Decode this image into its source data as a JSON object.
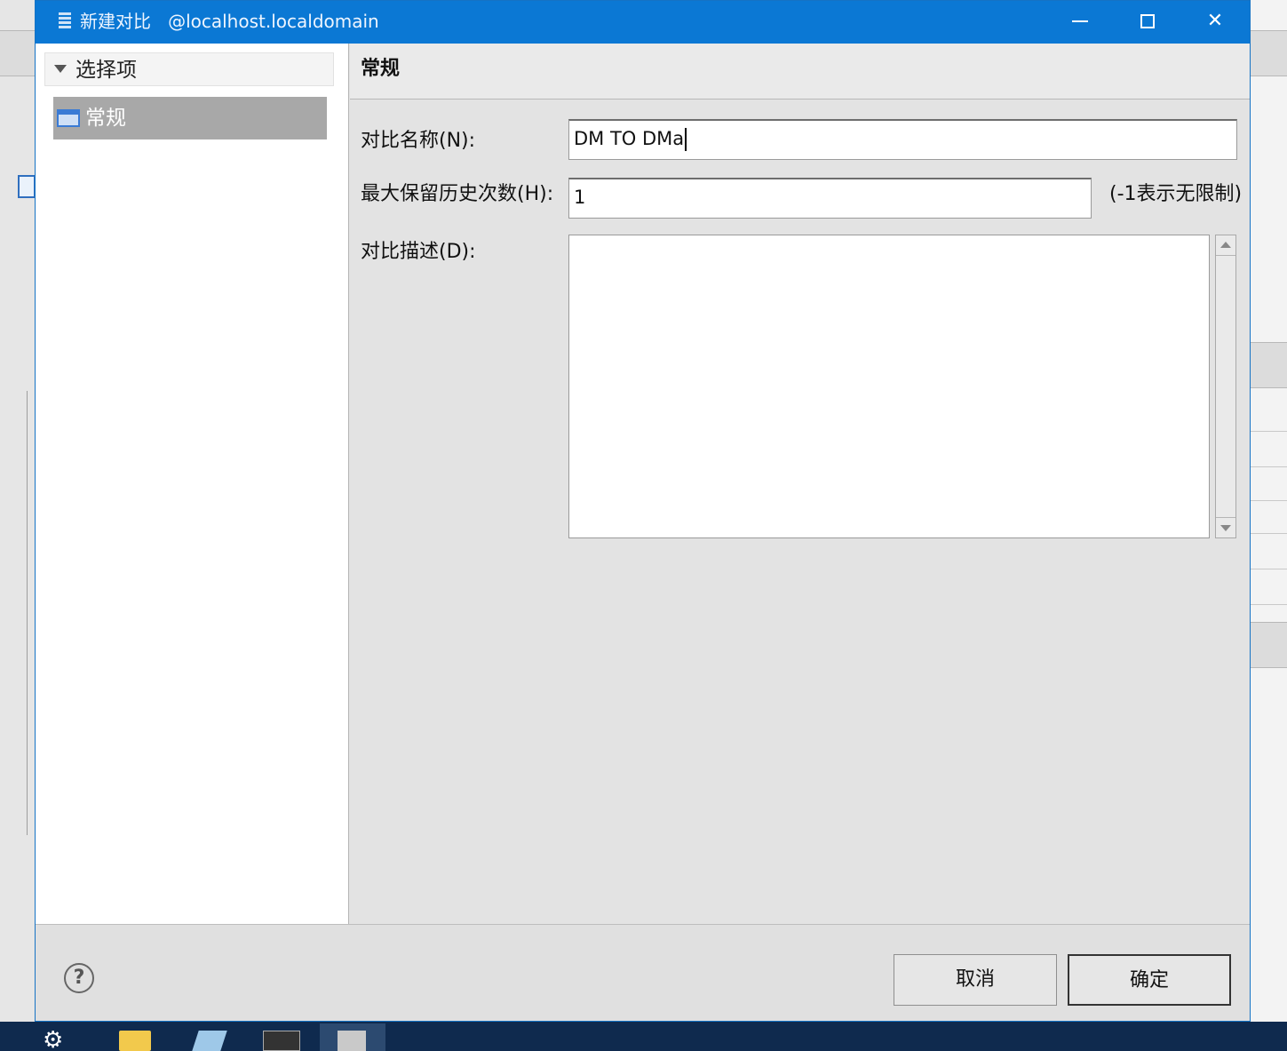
{
  "dialog": {
    "title": "新建对比",
    "connection": "@localhost.localdomain",
    "controls": {
      "minimize": "—",
      "maximize": "□",
      "close": "✕"
    }
  },
  "tree": {
    "header": "选择项",
    "items": [
      {
        "label": "常规",
        "selected": true
      }
    ]
  },
  "section": {
    "title": "常规"
  },
  "form": {
    "name_label": "对比名称(N):",
    "name_value": "DM TO DMa",
    "history_label": "最大保留历史次数(H):",
    "history_value": "1",
    "history_hint": "(-1表示无限制)",
    "desc_label": "对比描述(D):",
    "desc_value": ""
  },
  "buttons": {
    "help": "?",
    "cancel": "取消",
    "ok": "确定"
  },
  "icons": {
    "app": "database-compare-icon",
    "tree_item": "form-page-icon",
    "taskbar": [
      "settings-icon",
      "folder-icon",
      "eraser-icon",
      "terminal-icon",
      "database-icon"
    ]
  },
  "colors": {
    "titlebar": "#0b78d4",
    "taskbar": "#0f2a4e",
    "selection": "#a8a8a8"
  }
}
